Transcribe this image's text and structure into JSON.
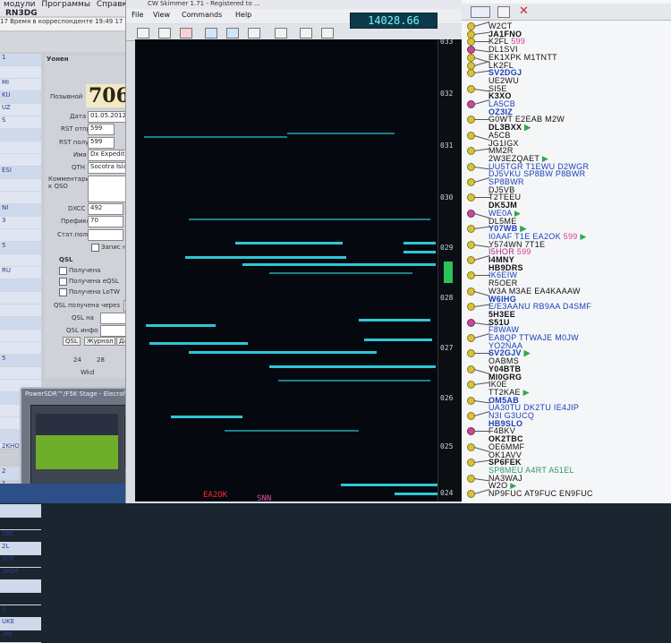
{
  "log": {
    "menu": [
      "модули",
      "Программы",
      "Справка"
    ],
    "title": "RN3DG",
    "status_line": "17  Время в корреспонденте 19:49 17",
    "tab": "Уонен",
    "callsign_label": "Позывной",
    "big_number": "706",
    "fields": [
      {
        "label": "Дата",
        "value": "01.05.2012"
      },
      {
        "label": "RST отпр",
        "value": "599"
      },
      {
        "label": "RST получ",
        "value": "599"
      },
      {
        "label": "Имя",
        "value": "Dx Expeditio"
      },
      {
        "label": "QTH",
        "value": "Socotra Isla"
      },
      {
        "label": "DXCC",
        "value": "492"
      },
      {
        "label": "Префикс",
        "value": "70"
      },
      {
        "label": "Стат.полн",
        "value": ""
      }
    ],
    "extra_label": "Комментарий к QSO",
    "save_check": "Запис на",
    "qsl_title": "QSL",
    "qsl_checks": [
      "Получена",
      "Получена eQSL",
      "Получена LoTW"
    ],
    "qsl_via_label": "QSL получена через",
    "qsl_na": "QSL на",
    "qsl_info": "QSL инфо",
    "qsl_tabs": [
      "QSL",
      "Журнал",
      "Дат"
    ],
    "bottom_nums": [
      "24",
      "28"
    ],
    "bottom_word": "Wkd",
    "list": [
      "1",
      "",
      "MI",
      "KU",
      "UZ",
      "S",
      "",
      "",
      "",
      "ESI",
      "",
      "",
      "NI",
      "3",
      "",
      "5",
      "",
      "RU",
      "",
      "",
      "",
      "",
      "",
      "",
      "5",
      "",
      "",
      "",
      "",
      "",
      "",
      "2KHO",
      "",
      "2",
      "1",
      "",
      "",
      "",
      "2BC",
      "2L",
      "3CF",
      "3HDF",
      "",
      "",
      "3",
      "UKE",
      "3M"
    ]
  },
  "powersdr": {
    "title": "PowerSDR™/F5K Stage - Elecraft K..."
  },
  "skimmer": {
    "title": "CW Skimmer 1.71 - Registered to ...",
    "menu": [
      "File",
      "View",
      "Commands",
      "Help"
    ],
    "freq": "14028.66",
    "freq_icon": "88",
    "scale_ticks": [
      "033",
      "032",
      "031",
      "030",
      "029",
      "028",
      "027",
      "026",
      "025",
      "024"
    ],
    "bottom_labels": [
      "EA2OK",
      "SNN"
    ]
  },
  "calls": {
    "rows": [
      {
        "t": "W2CT",
        "b": false
      },
      {
        "t": "JA1FNO",
        "b": true
      },
      {
        "t": "K2FL",
        "x": "599",
        "b": false
      },
      {
        "t": "DL1SVI",
        "b": false
      },
      {
        "t": "EK1XPK M1TNTT",
        "b": false
      },
      {
        "t": "LK2FL",
        "b": false
      },
      {
        "t": "SV2DGJ",
        "b": true,
        "c": "#1a3fb8"
      },
      {
        "t": "UE2WU",
        "b": false
      },
      {
        "t": "SI5E",
        "b": false
      },
      {
        "t": "K3XO",
        "b": true
      },
      {
        "t": "LA5CB",
        "b": false,
        "c": "#1a3fb8"
      },
      {
        "t": "OZ3IZ",
        "b": true,
        "c": "#1a3fb8"
      },
      {
        "t": "G0WT E2EAB M2W",
        "b": false
      },
      {
        "t": "DL3BXX",
        "b": true,
        "tri": true
      },
      {
        "t": "A5CB",
        "b": false
      },
      {
        "t": "JG1IGX",
        "b": false
      },
      {
        "t": "MM2R",
        "b": false
      },
      {
        "t": "2W3EZQAET",
        "b": false,
        "tri": true
      },
      {
        "t": "UU5TGR T1EWU D2WGR",
        "b": false,
        "c": "#1a3fb8"
      },
      {
        "t": "DJ5VKU SP8BW P8BWR",
        "b": false,
        "c": "#1a3fb8"
      },
      {
        "t": "SP8BWR",
        "b": false,
        "c": "#1a3fb8"
      },
      {
        "t": "DJ5VB",
        "b": false
      },
      {
        "t": "T2TEEU",
        "b": false
      },
      {
        "t": "DK5JM",
        "b": true
      },
      {
        "t": "WE0A",
        "b": false,
        "c": "#1a3fb8",
        "tri": true
      },
      {
        "t": "DL5ME",
        "b": false
      },
      {
        "t": "Y07WB",
        "b": true,
        "c": "#1a3fb8",
        "tri": true
      },
      {
        "t": "I0AAF T1E EA2OK",
        "x": "599",
        "b": false,
        "c": "#1a3fb8",
        "tri": true
      },
      {
        "t": "Y574WN 7T1E",
        "b": false
      },
      {
        "t": "I5HOR",
        "x": "599",
        "b": false,
        "c": "#b0208a"
      },
      {
        "t": "I4MNY",
        "b": true
      },
      {
        "t": "HB9DRS",
        "b": true
      },
      {
        "t": "IK6EIW",
        "b": false,
        "c": "#1a3fb8"
      },
      {
        "t": "R5OER",
        "b": false
      },
      {
        "t": "W3A M3AE EA4KAAAW",
        "b": false
      },
      {
        "t": "W6IHG",
        "b": true,
        "c": "#1a3fb8"
      },
      {
        "t": "E/E3AANU RB9AA D4SMF",
        "b": false,
        "c": "#1a3fb8"
      },
      {
        "t": "5H3EE",
        "b": true
      },
      {
        "t": "S51U",
        "b": true
      },
      {
        "t": "F8WAW",
        "b": false,
        "c": "#1a3fb8"
      },
      {
        "t": "EA8QP TTWAJE M0JW",
        "b": false,
        "c": "#1a3fb8"
      },
      {
        "t": "YO2NAA",
        "b": false,
        "c": "#1a3fb8"
      },
      {
        "t": "SV2GJV",
        "b": true,
        "c": "#1a3fb8",
        "tri": true
      },
      {
        "t": "OABMS",
        "b": false
      },
      {
        "t": "Y04BTB",
        "b": true
      },
      {
        "t": "MI0GRG",
        "b": true
      },
      {
        "t": "IK0E",
        "b": false
      },
      {
        "t": "TT2KAE",
        "b": false,
        "tri": true
      },
      {
        "t": "OM5AB",
        "b": true,
        "c": "#1a3fb8"
      },
      {
        "t": "UA30TU DK2TU IE4JIP",
        "b": false,
        "c": "#1a3fb8"
      },
      {
        "t": "N3I G3UCQ",
        "b": false,
        "c": "#1a3fb8"
      },
      {
        "t": "HB9SLO",
        "b": true,
        "c": "#1a3fb8"
      },
      {
        "t": "F4BKV",
        "b": false
      },
      {
        "t": "OK2TBC",
        "b": true
      },
      {
        "t": "OE6MMF",
        "b": false
      },
      {
        "t": "OK1AVV",
        "b": false
      },
      {
        "t": "SP6FEK",
        "b": true
      },
      {
        "t": "SP8MEU A4RT A51EL",
        "b": false,
        "c": "#2a9a5a"
      },
      {
        "t": "NA3WAJ",
        "b": false
      },
      {
        "t": "W2O",
        "b": false,
        "tri": true
      },
      {
        "t": "NP9FUC AT9FUC EN9FUC",
        "b": false
      }
    ]
  }
}
